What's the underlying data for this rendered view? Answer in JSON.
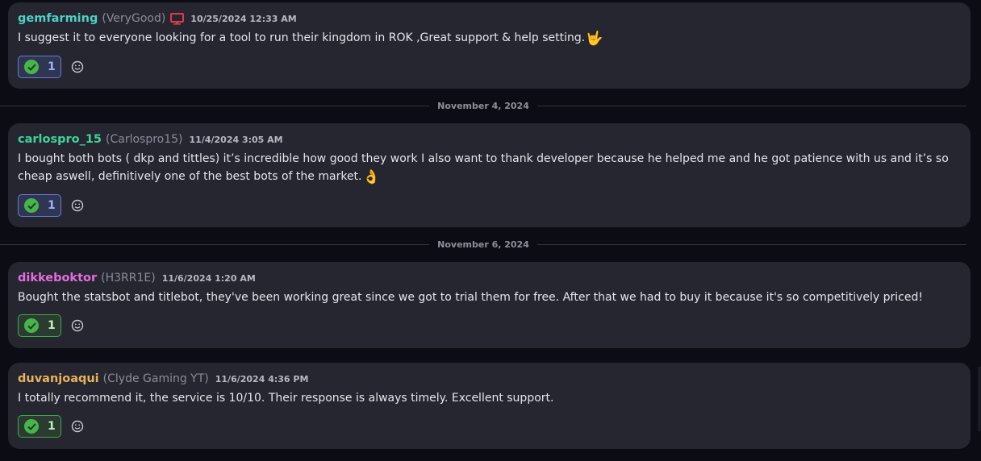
{
  "messages": [
    {
      "username": "gemfarming",
      "username_color": "#4fd1c5",
      "alias": "(VeryGood)",
      "device_icon": "monitor-icon",
      "timestamp": "10/25/2024 12:33 AM",
      "text": "I suggest it to everyone looking for a tool to run their kingdom in ROK ,Great support & help setting.",
      "emoji": "🤟",
      "reaction_count": "1",
      "reaction_style": "blue"
    },
    {
      "username": "carlospro_15",
      "username_color": "#3fd39a",
      "alias": "(Carlospro15)",
      "timestamp": "11/4/2024 3:05 AM",
      "text": "I bought both bots ( dkp and tittles) it’s incredible how good they work I also want to thank developer because he helped  me and he got patience with us and it’s so cheap aswell, definitively one of the best bots of the market.",
      "emoji": "👌",
      "reaction_count": "1",
      "reaction_style": "blue"
    },
    {
      "username": "dikkeboktor",
      "username_color": "#e36ee0",
      "alias": "(H3RR1E)",
      "timestamp": "11/6/2024 1:20 AM",
      "text": "Bought the statsbot and titlebot, they've been working great since we got to trial them for free. After that we had to buy it because it's so competitively priced!",
      "emoji": "",
      "reaction_count": "1",
      "reaction_style": "green"
    },
    {
      "username": "duvanjoaqui",
      "username_color": "#e9b25c",
      "alias": "(Clyde Gaming YT)",
      "timestamp": "11/6/2024 4:36 PM",
      "text": "I totally recommend it, the service is 10/10. Their response is always timely. Excellent support.",
      "emoji": "",
      "reaction_count": "1",
      "reaction_style": "green"
    }
  ],
  "dividers": [
    "November 4, 2024",
    "November 6, 2024"
  ],
  "icons": {
    "reaction": "green-check-icon",
    "add_reaction": "smiley-add-reaction-icon",
    "device": "monitor-icon"
  },
  "colors": {
    "background": "#0c0c15",
    "card": "#25262f",
    "device_icon": "#e0394a"
  }
}
